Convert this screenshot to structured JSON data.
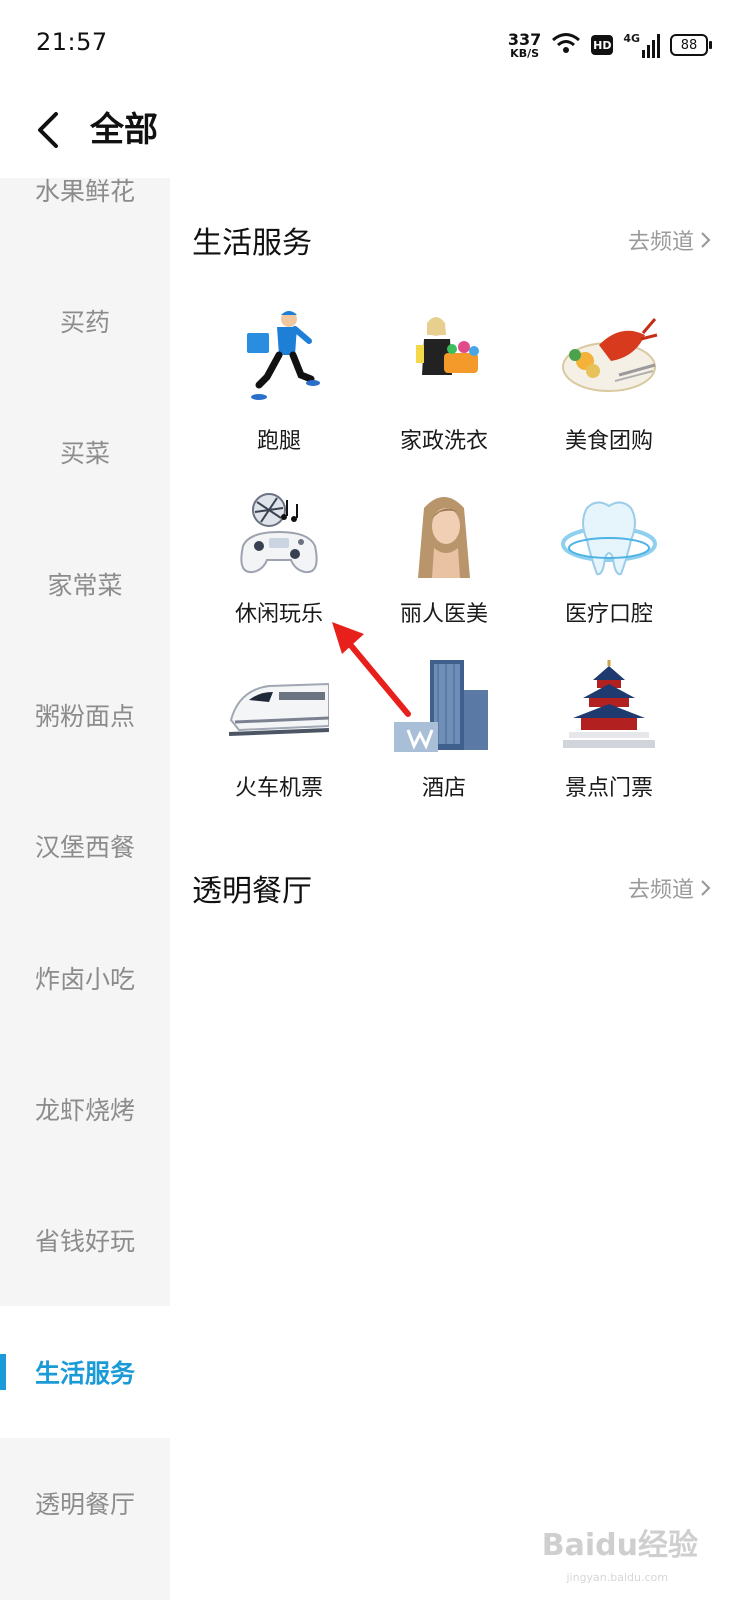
{
  "status": {
    "time": "21:57",
    "speed_value": "337",
    "speed_unit": "KB/S",
    "hd": "HD",
    "network": "4G",
    "battery": "88"
  },
  "header": {
    "title": "全部"
  },
  "sidebar": {
    "items": [
      {
        "label": "水果鲜花"
      },
      {
        "label": "买药"
      },
      {
        "label": "买菜"
      },
      {
        "label": "家常菜"
      },
      {
        "label": "粥粉面点"
      },
      {
        "label": "汉堡西餐"
      },
      {
        "label": "炸卤小吃"
      },
      {
        "label": "龙虾烧烤"
      },
      {
        "label": "省钱好玩"
      },
      {
        "label": "生活服务"
      },
      {
        "label": "透明餐厅"
      }
    ],
    "active": "生活服务"
  },
  "sections": [
    {
      "title": "生活服务",
      "link": "去频道",
      "items": [
        {
          "label": "跑腿"
        },
        {
          "label": "家政洗衣"
        },
        {
          "label": "美食团购"
        },
        {
          "label": "休闲玩乐"
        },
        {
          "label": "丽人医美"
        },
        {
          "label": "医疗口腔"
        },
        {
          "label": "火车机票"
        },
        {
          "label": "酒店"
        },
        {
          "label": "景点门票"
        }
      ]
    },
    {
      "title": "透明餐厅",
      "link": "去频道"
    }
  ],
  "watermark": {
    "text": "Baidu经验",
    "sub": "jingyan.baidu.com"
  },
  "colors": {
    "accent": "#1a9bd7",
    "sidebar_bg": "#f5f5f5",
    "muted_text": "#8c8c8c",
    "annotation_arrow": "#e8201c"
  }
}
